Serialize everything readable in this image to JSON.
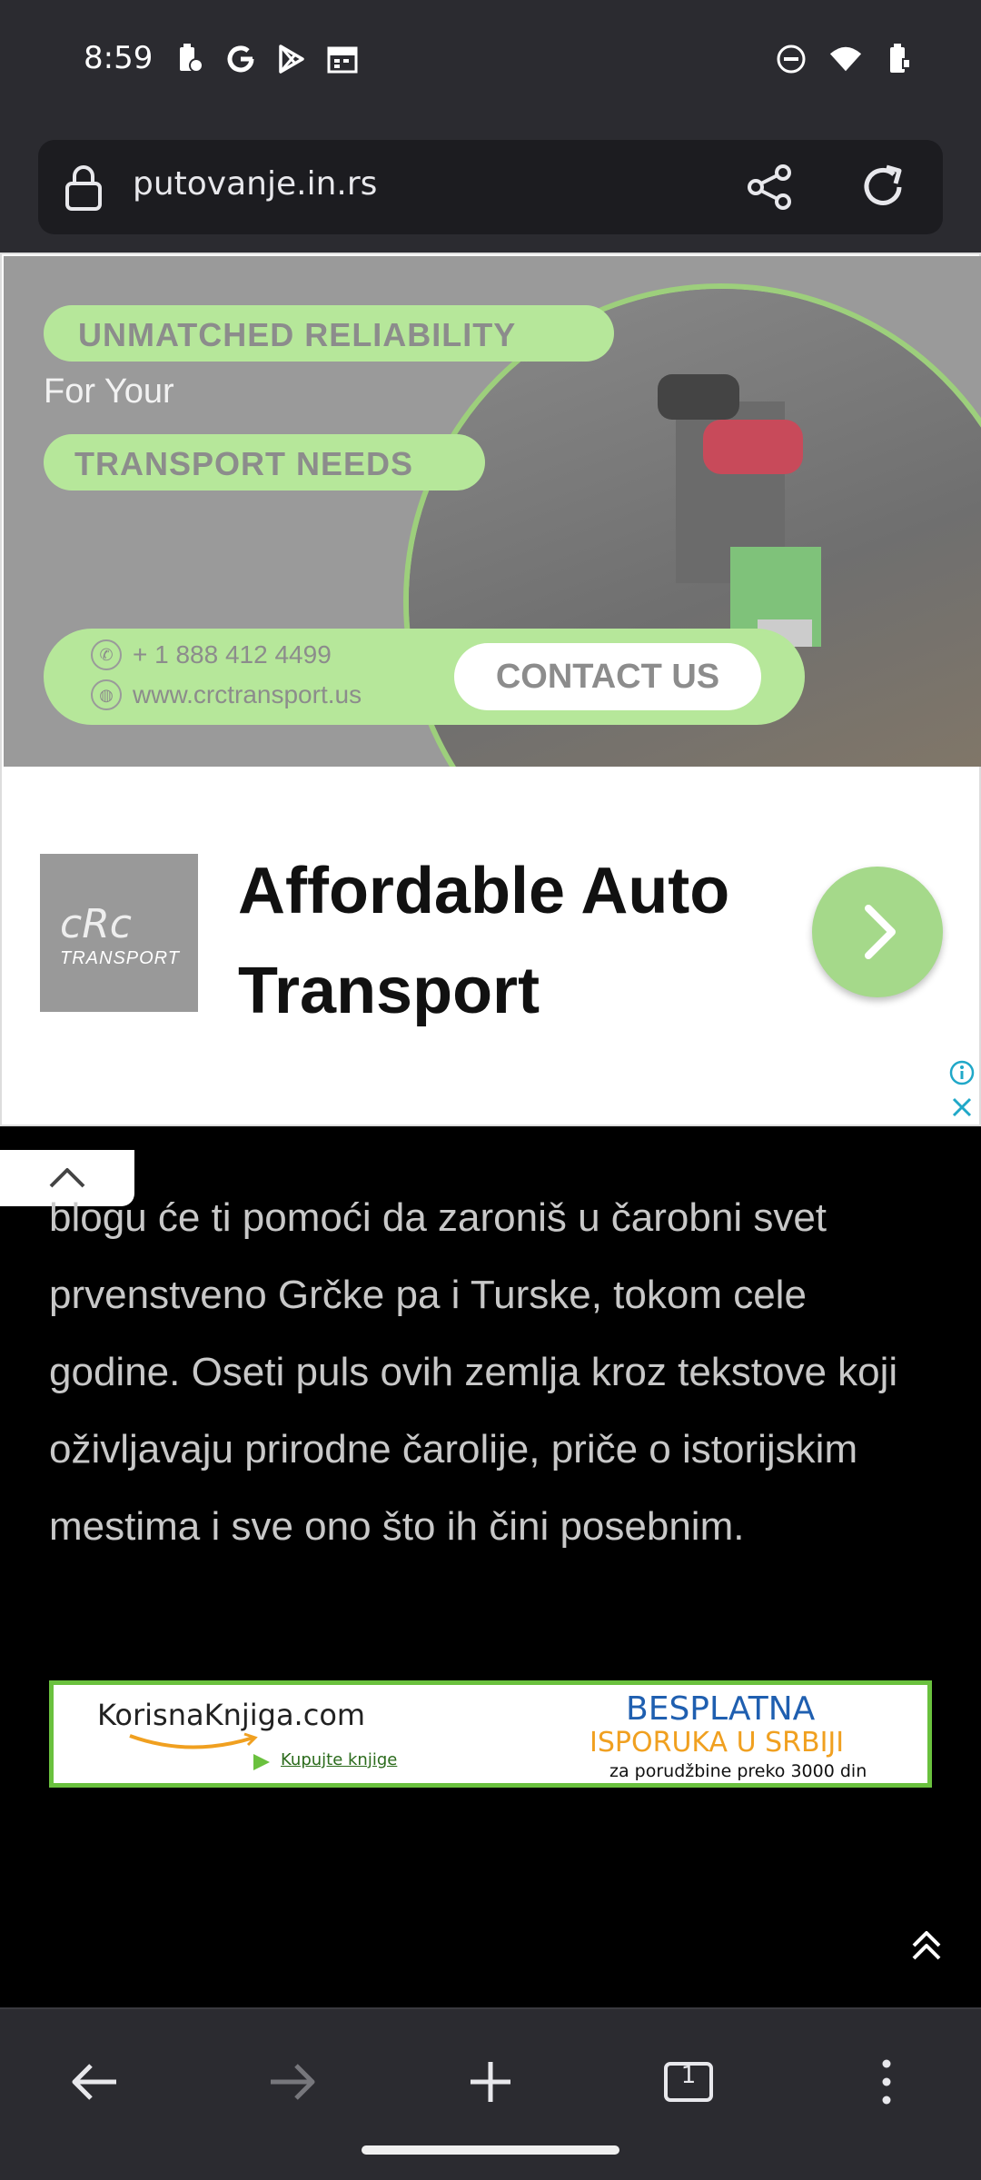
{
  "status_bar": {
    "time": "8:59",
    "left_icons": [
      "battery-saver-icon",
      "google-icon",
      "play-store-icon",
      "calendar-icon"
    ],
    "right_icons": [
      "dnd-icon",
      "wifi-icon",
      "battery-icon"
    ]
  },
  "browser": {
    "url": "putovanje.in.rs",
    "tab_count": "1"
  },
  "ad": {
    "headline_1": "UNMATCHED RELIABILITY",
    "for_your": "For Your",
    "headline_2": "TRANSPORT NEEDS",
    "phone": "+ 1 888 412 4499",
    "website": "www.crctransport.us",
    "contact_label": "CONTACT US",
    "logo_text": "cRc",
    "logo_sub": "TRANSPORT",
    "title": "Affordable Auto Transport"
  },
  "article": {
    "text": "blogu će ti pomoći da zaroniš u čarobni svet prvenstveno Grčke pa i Turske, tokom cele godine. Oseti puls ovih zemlja kroz tekstove koji oživljavaju prirodne čarolije, priče o istorijskim mestima i sve ono što ih čini posebnim."
  },
  "promo": {
    "brand": "KorisnaKnjiga.com",
    "link": "Kupujte knjige",
    "line1": "BESPLATNA",
    "line2": "ISPORUKA U SRBIJI",
    "line3": "za porudžbine preko 3000 din"
  },
  "colors": {
    "chrome": "#2b2b30",
    "ad_green": "#b6e79a",
    "promo_border": "#6ac13e"
  }
}
